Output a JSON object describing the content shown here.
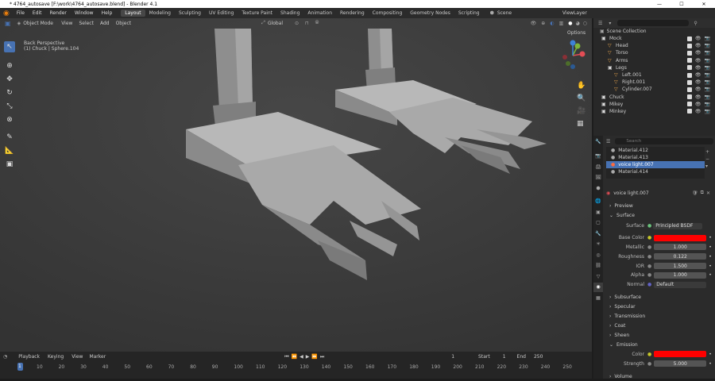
{
  "window": {
    "title": "* 4764_autosave [F:\\work\\4764_autosave.blend] - Blender 4.1",
    "min": "—",
    "max": "☐",
    "close": "✕"
  },
  "menus": [
    "File",
    "Edit",
    "Render",
    "Window",
    "Help"
  ],
  "workspaces": [
    "Layout",
    "Modeling",
    "Sculpting",
    "UV Editing",
    "Texture Paint",
    "Shading",
    "Animation",
    "Rendering",
    "Compositing",
    "Geometry Nodes",
    "Scripting"
  ],
  "scene": {
    "name": "Scene",
    "view_layer": "ViewLayer"
  },
  "viewport": {
    "mode": "Object Mode",
    "menus": [
      "View",
      "Select",
      "Add",
      "Object"
    ],
    "orientation": "Global",
    "options": "Options",
    "info_line1": "Back Perspective",
    "info_line2": "(1) Chuck | Sphere.104"
  },
  "timeline": {
    "menus": [
      "Playback",
      "Keying",
      "View",
      "Marker"
    ],
    "current": "1",
    "start_label": "Start",
    "start": "1",
    "end_label": "End",
    "end": "250",
    "ticks": [
      "10",
      "20",
      "30",
      "40",
      "50",
      "60",
      "70",
      "80",
      "90",
      "100",
      "110",
      "120",
      "130",
      "140",
      "150",
      "160",
      "170",
      "180",
      "190",
      "200",
      "210",
      "220",
      "230",
      "240",
      "250"
    ],
    "cursor": "1"
  },
  "outliner": {
    "title": "Scene Collection",
    "items": [
      {
        "name": "Mock",
        "depth": 0,
        "icon": "collection"
      },
      {
        "name": "Head",
        "depth": 1,
        "icon": "object"
      },
      {
        "name": "Torso",
        "depth": 1,
        "icon": "object"
      },
      {
        "name": "Arms",
        "depth": 1,
        "icon": "object"
      },
      {
        "name": "Legs",
        "depth": 1,
        "icon": "collection"
      },
      {
        "name": "Left.001",
        "depth": 2,
        "icon": "object"
      },
      {
        "name": "Right.001",
        "depth": 2,
        "icon": "object"
      },
      {
        "name": "Cylinder.007",
        "depth": 2,
        "icon": "object"
      },
      {
        "name": "Chuck",
        "depth": 0,
        "icon": "collection"
      },
      {
        "name": "Mikey",
        "depth": 0,
        "icon": "collection"
      },
      {
        "name": "Minkey",
        "depth": 0,
        "icon": "collection"
      }
    ]
  },
  "materials": {
    "slots": [
      "Material.412",
      "Material.413",
      "voice light.007",
      "Material.414"
    ],
    "selected": "voice light.007",
    "search": "Search"
  },
  "material_panel": {
    "name": "voice light.007",
    "preview": "Preview",
    "surface_section": "Surface",
    "surface_label": "Surface",
    "surface_value": "Principled BSDF",
    "rows": [
      {
        "label": "Base Color",
        "value": "",
        "color": "#ff0000"
      },
      {
        "label": "Metallic",
        "value": "1.000"
      },
      {
        "label": "Roughness",
        "value": "0.122"
      },
      {
        "label": "IOR",
        "value": "1.500"
      },
      {
        "label": "Alpha",
        "value": "1.000"
      },
      {
        "label": "Normal",
        "value": "Default"
      }
    ],
    "sections": [
      "Subsurface",
      "Specular",
      "Transmission",
      "Coat",
      "Sheen"
    ],
    "emission": "Emission",
    "emission_color_label": "Color",
    "emission_color": "#ff0000",
    "strength_label": "Strength",
    "strength_value": "5.000",
    "volume": "Volume"
  }
}
